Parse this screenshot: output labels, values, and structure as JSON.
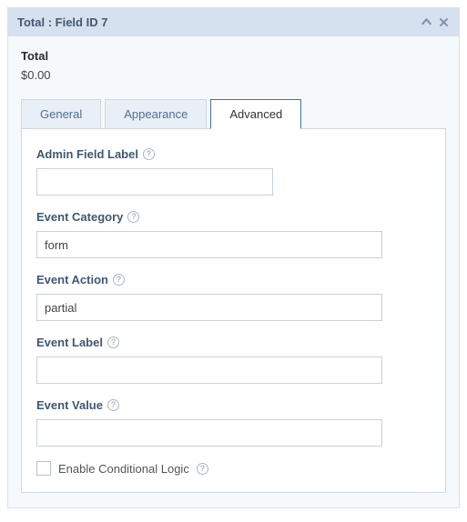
{
  "header": {
    "title": "Total : Field ID 7"
  },
  "preview": {
    "label": "Total",
    "value": "$0.00"
  },
  "tabs": {
    "general": "General",
    "appearance": "Appearance",
    "advanced": "Advanced"
  },
  "fields": {
    "admin_label": {
      "label": "Admin Field Label",
      "value": ""
    },
    "event_category": {
      "label": "Event Category",
      "value": "form"
    },
    "event_action": {
      "label": "Event Action",
      "value": "partial"
    },
    "event_label": {
      "label": "Event Label",
      "value": ""
    },
    "event_value": {
      "label": "Event Value",
      "value": ""
    },
    "cond_logic": {
      "label": "Enable Conditional Logic"
    }
  }
}
